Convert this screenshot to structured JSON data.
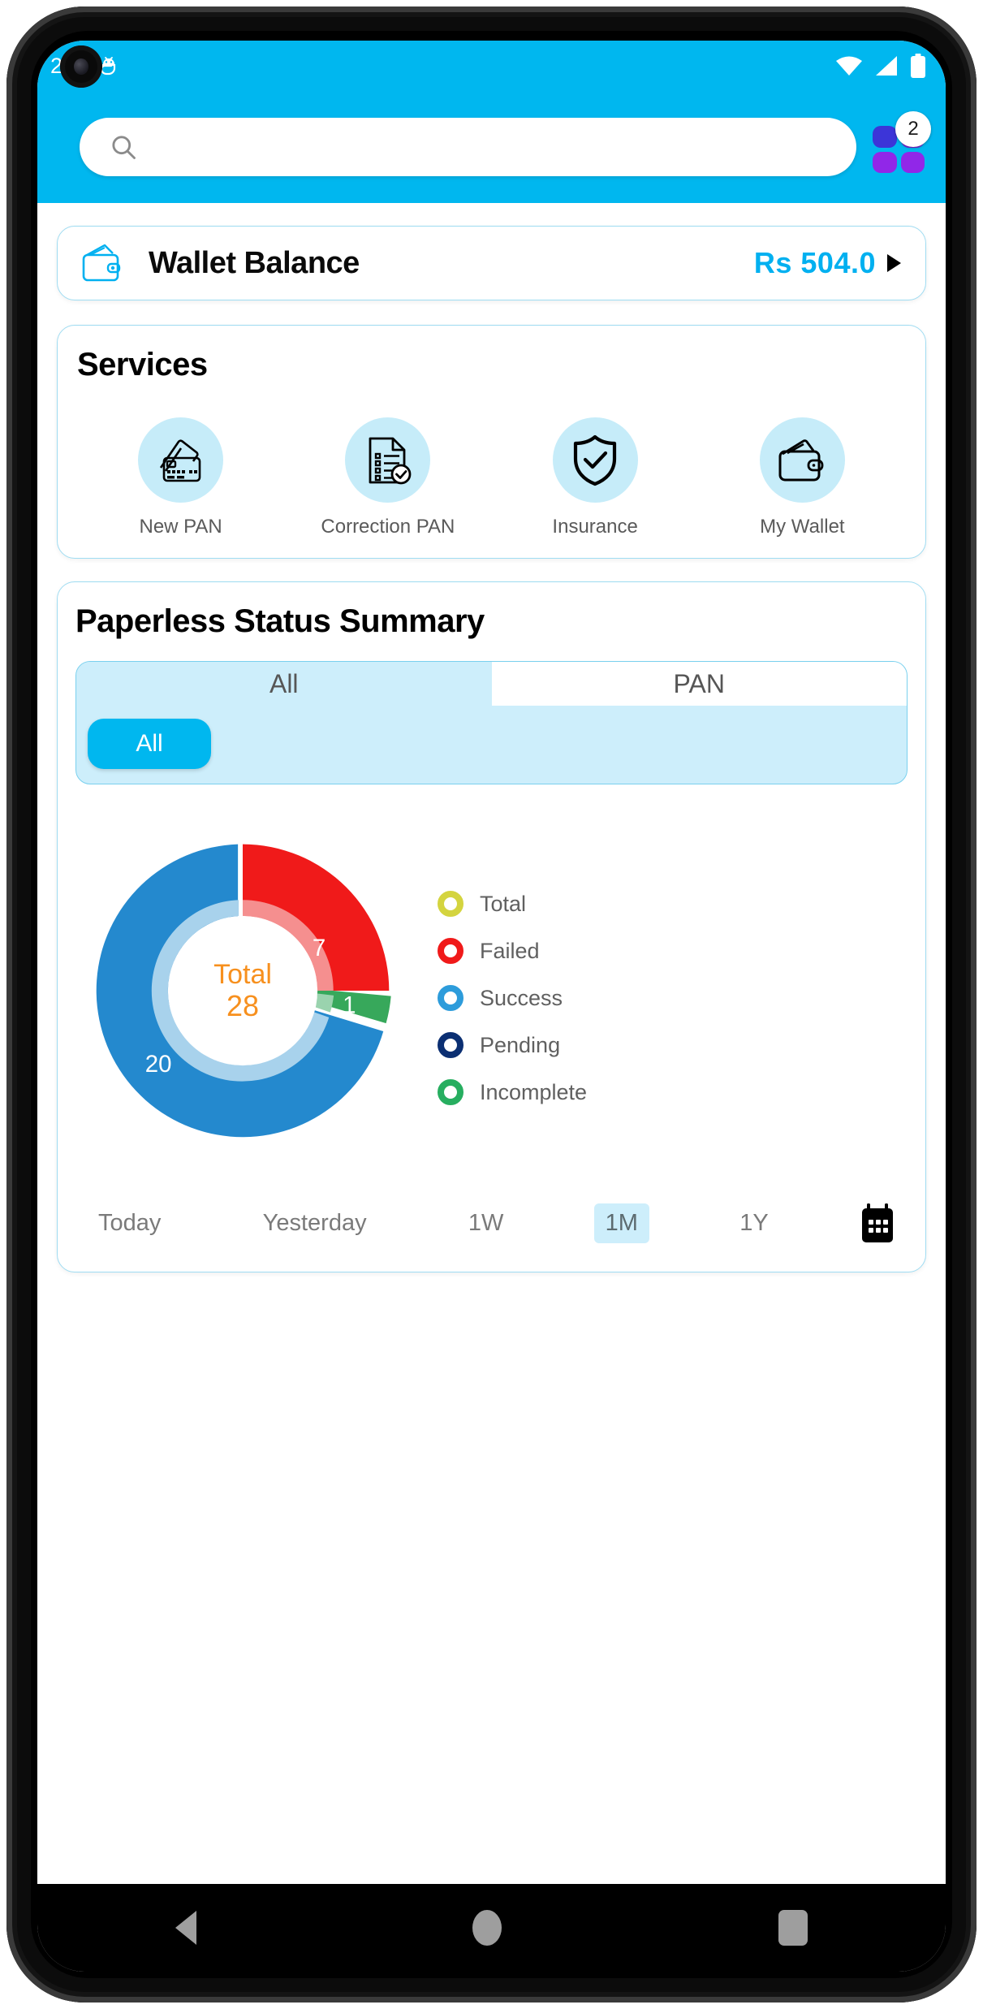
{
  "status_bar": {
    "clock": "2",
    "icons": [
      "sd-card-icon",
      "android-debug-icon",
      "wifi-icon",
      "cellular-signal-icon",
      "battery-icon"
    ]
  },
  "header": {
    "search": {
      "value": "",
      "placeholder": ""
    },
    "apps_button": {
      "badge": "2"
    }
  },
  "wallet": {
    "title": "Wallet Balance",
    "amount": "Rs  504.0"
  },
  "services": {
    "title": "Services",
    "items": [
      {
        "label": "New PAN",
        "icon": "credit-cards-icon"
      },
      {
        "label": "Correction PAN",
        "icon": "document-checklist-icon"
      },
      {
        "label": "Insurance",
        "icon": "shield-check-icon"
      },
      {
        "label": "My Wallet",
        "icon": "wallet-icon"
      }
    ]
  },
  "summary": {
    "title": "Paperless Status Summary",
    "tabs": [
      {
        "label": "All",
        "active": true
      },
      {
        "label": "PAN",
        "active": false
      }
    ],
    "chips": [
      {
        "label": "All",
        "active": true
      }
    ],
    "ranges": [
      {
        "label": "Today",
        "active": false
      },
      {
        "label": "Yesterday",
        "active": false
      },
      {
        "label": "1W",
        "active": false
      },
      {
        "label": "1M",
        "active": true
      },
      {
        "label": "1Y",
        "active": false
      }
    ],
    "calendar_icon": "calendar-icon"
  },
  "chart_data": {
    "type": "pie",
    "title": "Paperless Status Summary",
    "center_label": "Total",
    "center_value": "28",
    "center_color": "#F7901E",
    "categories": [
      "Failed",
      "Incomplete",
      "Success"
    ],
    "values": [
      7,
      1,
      20
    ],
    "data_labels": [
      "7",
      "1",
      "20"
    ],
    "colors": [
      "#F01A1A",
      "#37A85B",
      "#2489CE"
    ],
    "total": 28,
    "legend_position": "right",
    "legend": [
      {
        "label": "Total",
        "color": "#D4D43F"
      },
      {
        "label": "Failed",
        "color": "#F01A1A"
      },
      {
        "label": "Success",
        "color": "#2D9CDB"
      },
      {
        "label": "Pending",
        "color": "#0B2F72"
      },
      {
        "label": "Incomplete",
        "color": "#27AE60"
      }
    ],
    "grid": false
  },
  "nav_bar": {
    "items": [
      "back-icon",
      "home-icon",
      "recents-icon"
    ]
  }
}
